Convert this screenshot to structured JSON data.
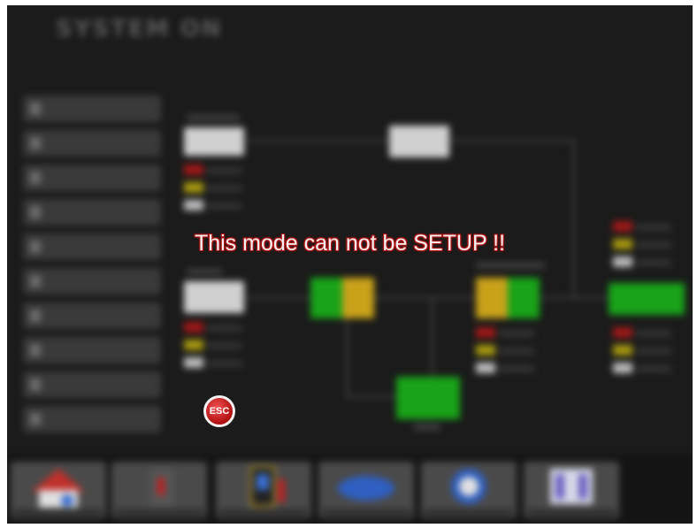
{
  "header": {
    "title": "SYSTEM ON",
    "subtitle": ""
  },
  "overlay": {
    "message": "This mode can not be SETUP !!",
    "esc_label": "ESC"
  },
  "taskbar": {
    "clock": ""
  },
  "colors": {
    "alarm_red": "#a01818",
    "warning_yellow": "#c9a21a",
    "normal_green": "#19a319",
    "message_glow": "#b31414"
  }
}
